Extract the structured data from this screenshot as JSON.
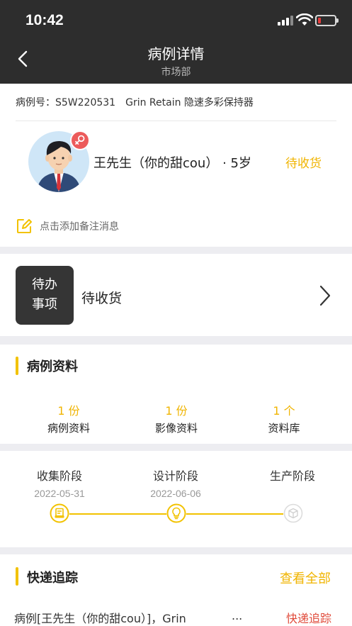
{
  "status_bar": {
    "time": "10:42"
  },
  "nav": {
    "title": "病例详情",
    "subtitle": "市场部",
    "back_icon": "chevron-left-icon"
  },
  "case": {
    "number_label": "病例号：S5W220531",
    "product": "Grin Retain 隐速多彩保持器",
    "patient_name": "王先生（你的甜cou）",
    "age": "· 5岁",
    "status": "待收货",
    "note_placeholder": "点击添加备注消息"
  },
  "todo": {
    "label_line1": "待办",
    "label_line2": "事项",
    "status": "待收货"
  },
  "records": {
    "title": "病例资料",
    "items": [
      {
        "count": "1 份",
        "label": "病例资料"
      },
      {
        "count": "1 份",
        "label": "影像资料"
      },
      {
        "count": "1 个",
        "label": "资料库"
      }
    ]
  },
  "stages": [
    {
      "name": "收集阶段",
      "date": "2022-05-31",
      "icon": "document-stage-icon",
      "active": true
    },
    {
      "name": "设计阶段",
      "date": "2022-06-06",
      "icon": "lightbulb-stage-icon",
      "active": true
    },
    {
      "name": "生产阶段",
      "date": "",
      "icon": "box-stage-icon",
      "active": false
    }
  ],
  "tracking": {
    "title": "快递追踪",
    "view_all": "查看全部",
    "entry_text": "病例[王先生（你的甜cou）]，Grin",
    "ellipsis": "...",
    "link": "快递追踪"
  },
  "colors": {
    "accent": "#f2c200",
    "accent_text": "#f0b400",
    "header_bg": "#2d2d2d",
    "link_red": "#e04a3a",
    "gender_badge": "#ec5b5b"
  }
}
